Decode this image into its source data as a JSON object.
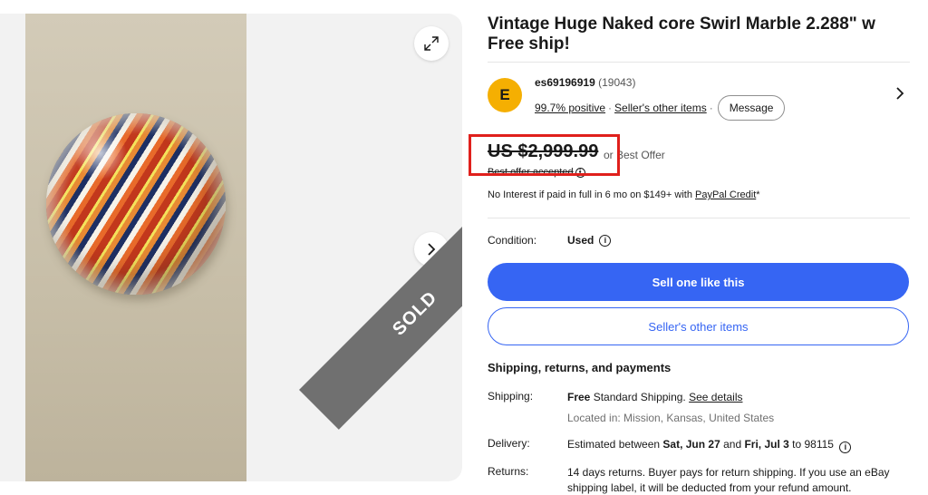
{
  "gallery": {
    "sold_label": "SOLD"
  },
  "title": "Vintage Huge Naked core Swirl Marble 2.288\" w Free ship!",
  "seller": {
    "avatar_letter": "E",
    "name": "es69196919",
    "feedback_count": "(19043)",
    "positive": "99.7% positive",
    "separator": "·",
    "other_items_link": "Seller's other items",
    "message_button": "Message"
  },
  "price": {
    "amount": "US $2,999.99",
    "offer_text": "or Best Offer",
    "accepted_text": "Best offer accepted",
    "credit_prefix": "No Interest if paid in full in 6 mo on $149+ with ",
    "credit_link": "PayPal Credit",
    "credit_suffix": "*"
  },
  "condition": {
    "label": "Condition:",
    "value": "Used"
  },
  "actions": {
    "primary": "Sell one like this",
    "secondary": "Seller's other items"
  },
  "shipping": {
    "heading": "Shipping, returns, and payments",
    "shipping_label": "Shipping:",
    "shipping_free": "Free",
    "shipping_method": " Standard Shipping. ",
    "see_details": "See details",
    "location": "Located in: Mission, Kansas, United States",
    "delivery_label": "Delivery:",
    "delivery_prefix": "Estimated between ",
    "delivery_start": "Sat, Jun 27",
    "delivery_and": " and ",
    "delivery_end": "Fri, Jul 3",
    "delivery_to": " to 98115",
    "returns_label": "Returns:",
    "returns_text": "14 days returns. Buyer pays for return shipping. If you use an eBay shipping label, it will be deducted from your refund amount."
  },
  "colors": {
    "primary_blue": "#3665f3",
    "highlight_red": "#e0201c",
    "avatar_yellow": "#f5af02",
    "sold_gray": "#707070"
  }
}
